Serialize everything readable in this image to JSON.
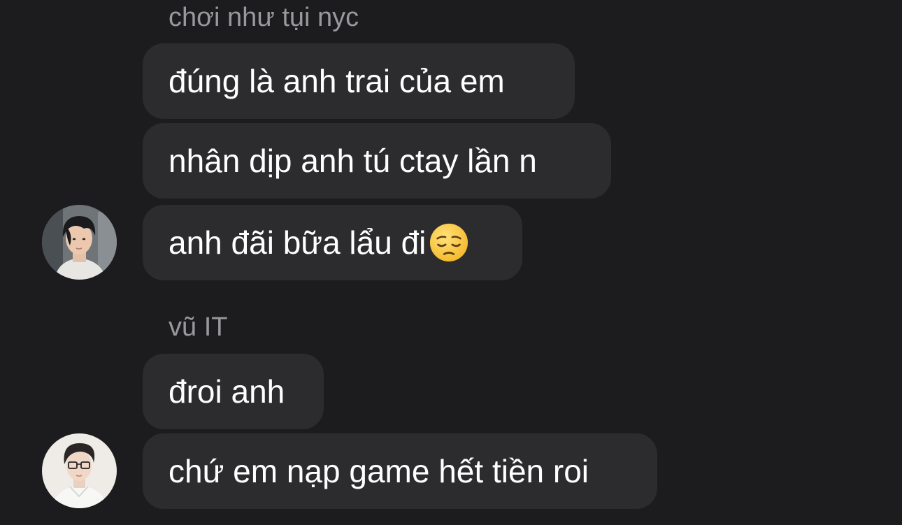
{
  "conversation": {
    "groups": [
      {
        "sender": "chơi như tụi nyc",
        "avatar": "avatar-dark-hair-male",
        "messages": [
          {
            "text": "đúng là anh trai của em"
          },
          {
            "text": "nhân dịp anh tú ctay lần n"
          },
          {
            "text": "anh đãi bữa lẩu đi",
            "emoji": "pensive-face-icon"
          }
        ]
      },
      {
        "sender": "vũ IT",
        "avatar": "avatar-glasses-male",
        "messages": [
          {
            "text": "đroi anh"
          },
          {
            "text": "chứ em nạp game hết tiền roi"
          }
        ]
      }
    ]
  },
  "colors": {
    "background": "#1c1c1e",
    "bubble": "#2c2c2e",
    "sender_text": "#98989d",
    "message_text": "#ffffff"
  }
}
